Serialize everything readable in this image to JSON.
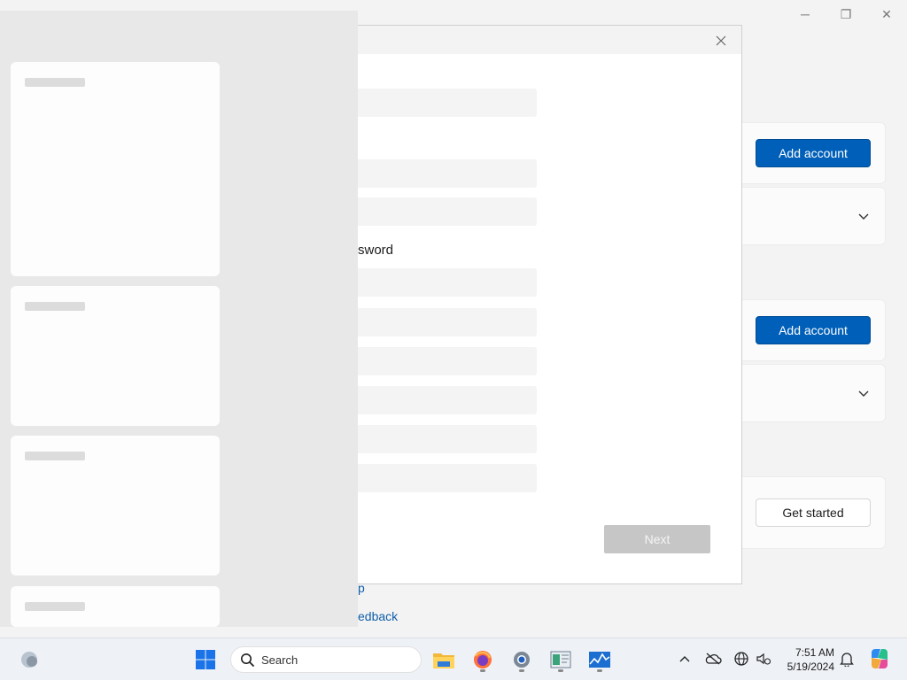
{
  "settings": {
    "window_controls": {
      "minimize": "─",
      "restore": "❐",
      "close": "✕"
    },
    "add_account_label_1": "Add account",
    "add_account_label_2": "Add account",
    "get_started_label": "Get started",
    "link_help": "p",
    "link_feedback": "edback"
  },
  "dialog": {
    "close_glyph": "✕",
    "password_label": "sword",
    "next_label": "Next"
  },
  "taskbar": {
    "search_placeholder": "Search",
    "time": "7:51 AM",
    "date": "5/19/2024",
    "pinned_icons": [
      "windows-start",
      "file-explorer",
      "firefox",
      "settings",
      "notepad-app",
      "task-manager"
    ],
    "tray_icons": [
      "chevron-up",
      "onedrive-offline",
      "network",
      "volume-settings",
      "notification-bell",
      "copilot-pre"
    ]
  }
}
